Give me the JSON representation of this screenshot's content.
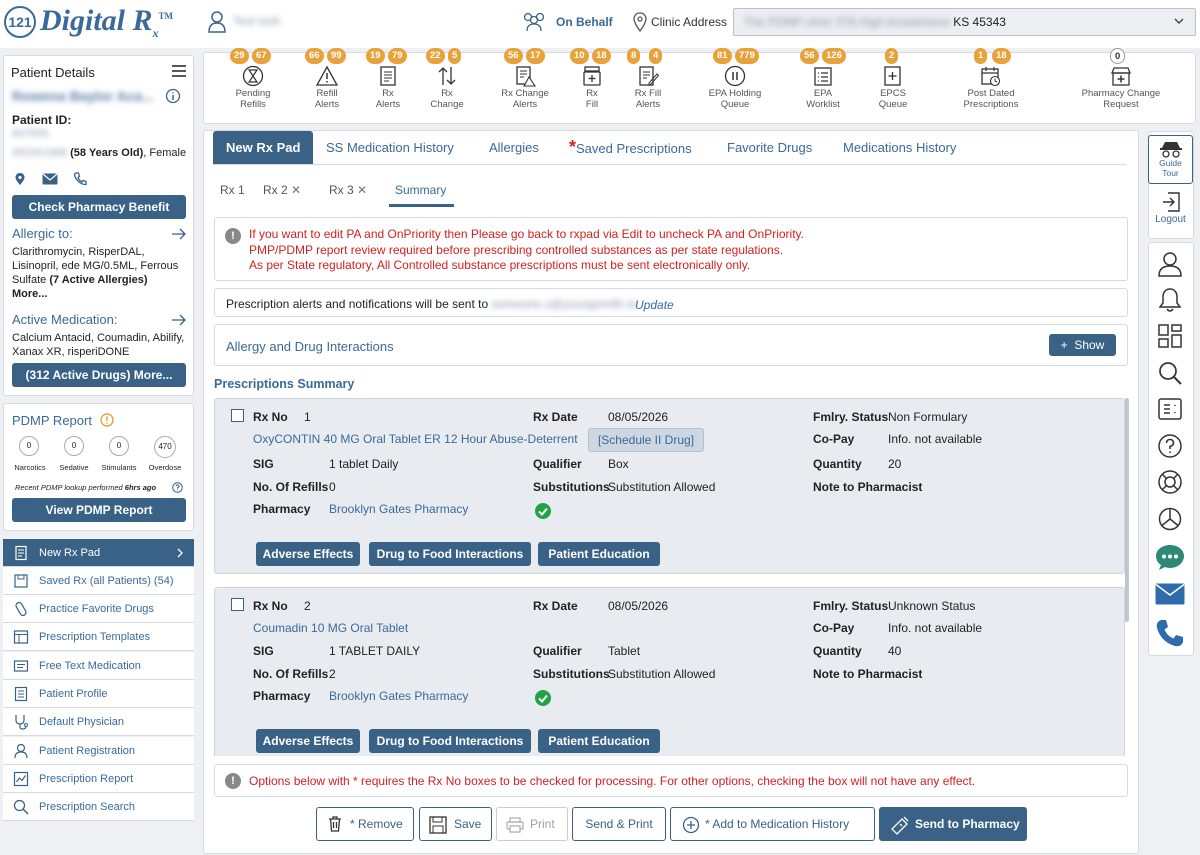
{
  "app": {
    "logo_mark": "121",
    "logo_text": "Digital R",
    "logo_sub": "x",
    "logo_tm": "TM"
  },
  "header": {
    "user_name": "Test lsoh",
    "on_behalf": "On Behalf",
    "clinic_label": "Clinic Address",
    "clinic_value_blur": "The PDMP clinic 378 High broadmeow",
    "clinic_value_tail": "KS 45343"
  },
  "patient": {
    "title": "Patient Details",
    "name_blur": "Rowena Baylor Aca...",
    "id_label": "Patient ID:",
    "id_blur": "847655",
    "dob_blur": "05/29/1968",
    "age": "(58 Years Old)",
    "gender": ", Female",
    "check_benefit": "Check Pharmacy Benefit",
    "allergic_title": "Allergic to:",
    "allergic_text": "Clarithromycin, RisperDAL, Lisinopril, ede MG/0.5ML, Ferrous Sulfate",
    "allergic_count": "(7 Active Allergies)",
    "allergic_more": "More...",
    "active_med_title": "Active Medication:",
    "active_med_text": "Calcium Antacid, Coumadin, Abilify, Xanax XR, risperiDONE",
    "active_drugs_btn": "(312 Active Drugs) More..."
  },
  "pdmp": {
    "title": "PDMP Report",
    "counters": [
      {
        "value": "0",
        "label": "Narcotics"
      },
      {
        "value": "0",
        "label": "Sedative"
      },
      {
        "value": "0",
        "label": "Stimulants"
      },
      {
        "value": "470",
        "label": "Overdose"
      }
    ],
    "lookup_prefix": "Recent PDMP lookup performed",
    "lookup_time": "6hrs ago",
    "view_btn": "View PDMP Report"
  },
  "menu": [
    {
      "label": "New Rx Pad"
    },
    {
      "label": "Saved Rx (all Patients) (54)"
    },
    {
      "label": "Practice Favorite Drugs"
    },
    {
      "label": "Prescription Templates"
    },
    {
      "label": "Free Text Medication"
    },
    {
      "label": "Patient Profile"
    },
    {
      "label": "Default Physician"
    },
    {
      "label": "Patient Registration"
    },
    {
      "label": "Prescription Report"
    },
    {
      "label": "Prescription Search"
    }
  ],
  "quickbar": [
    {
      "l1": "Pending",
      "l2": "Refills",
      "b1": "29",
      "b2": "67"
    },
    {
      "l1": "Refill",
      "l2": "Alerts",
      "b1": "66",
      "b2": "99"
    },
    {
      "l1": "Rx",
      "l2": "Alerts",
      "b1": "19",
      "b2": "79"
    },
    {
      "l1": "Rx",
      "l2": "Change",
      "b1": "22",
      "b2": "5"
    },
    {
      "l1": "Rx Change",
      "l2": "Alerts",
      "b1": "56",
      "b2": "17"
    },
    {
      "l1": "Rx",
      "l2": "Fill",
      "b1": "10",
      "b2": "18"
    },
    {
      "l1": "Rx Fill",
      "l2": "Alerts",
      "b1": "8",
      "b2": "4"
    },
    {
      "l1": "EPA Holding",
      "l2": "Queue",
      "b1": "81",
      "b2": "779"
    },
    {
      "l1": "EPA",
      "l2": "Worklist",
      "b1": "56",
      "b2": "126"
    },
    {
      "l1": "EPCS",
      "l2": "Queue",
      "b1": "2",
      "b2": ""
    },
    {
      "l1": "Post Dated",
      "l2": "Prescriptions",
      "b1": "1",
      "b2": "18"
    },
    {
      "l1": "Pharmacy Change",
      "l2": "Request",
      "b1": "0",
      "b2": ""
    }
  ],
  "tabs": [
    "New Rx Pad",
    "SS Medication History",
    "Allergies",
    "Saved Prescriptions",
    "Favorite Drugs",
    "Medications History"
  ],
  "tabs_required_mark": "*",
  "subtabs": [
    "Rx 1",
    "Rx 2",
    "Rx 3",
    "Summary"
  ],
  "alerts": {
    "lines": [
      "If you want to edit PA and OnPriority then Please go back to rxpad via Edit to uncheck PA and OnPriority.",
      "PMP/PDMP report review required before prescribing controlled substances as per state regulations.",
      "As per State regulatory, All Controlled substance prescriptions must be sent electronically only."
    ],
    "notify_prefix": "Prescription alerts and notifications will be sent to",
    "notify_email_blur": "someone.x@youngsmith.ie",
    "update": "Update"
  },
  "interactions": {
    "title": "Allergy and Drug Interactions",
    "show": "Show"
  },
  "summary_title": "Prescriptions Summary",
  "labels": {
    "rx_no": "Rx No",
    "rx_date": "Rx Date",
    "fmlry": "Fmlry. Status",
    "copay": "Co-Pay",
    "sig": "SIG",
    "qualifier": "Qualifier",
    "quantity": "Quantity",
    "refills": "No. Of Refills",
    "subs": "Substitutions",
    "note": "Note to Pharmacist",
    "pharmacy": "Pharmacy"
  },
  "prescriptions": [
    {
      "no": "1",
      "date": "08/05/2026",
      "fmlry": "Non Formulary",
      "copay": "Info. not available",
      "drug": "OxyCONTIN 40 MG Oral Tablet ER 12 Hour Abuse-Deterrent",
      "schedule": "[Schedule II Drug]",
      "sig": "1 tablet Daily",
      "qualifier": "Box",
      "quantity": "20",
      "refills": "0",
      "subs": "Substitution Allowed",
      "pharmacy": "Brooklyn Gates Pharmacy"
    },
    {
      "no": "2",
      "date": "08/05/2026",
      "fmlry": "Unknown Status",
      "copay": "Info. not available",
      "drug": "Coumadin 10 MG Oral Tablet",
      "schedule": "",
      "sig": "1 TABLET DAILY",
      "qualifier": "Tablet",
      "quantity": "40",
      "refills": "2",
      "subs": "Substitution Allowed",
      "pharmacy": "Brooklyn Gates Pharmacy"
    }
  ],
  "card_buttons": {
    "adverse": "Adverse Effects",
    "food": "Drug to Food Interactions",
    "education": "Patient Education"
  },
  "options_note": "Options below with * requires the Rx No boxes to be checked for processing. For other options, checking the box will not have any effect.",
  "bottom_buttons": {
    "remove": "* Remove",
    "save": "Save",
    "print": "Print",
    "send_print": "Send & Print",
    "add_history": "* Add to Medication History",
    "send_pharmacy": "Send to Pharmacy"
  },
  "right_rail": {
    "guide_tour_1": "Guide",
    "guide_tour_2": "Tour",
    "logout": "Logout"
  },
  "colors": {
    "primary": "#3a6287",
    "badge": "#e8a23a",
    "alert_red": "#d32020",
    "success": "#22a246"
  }
}
